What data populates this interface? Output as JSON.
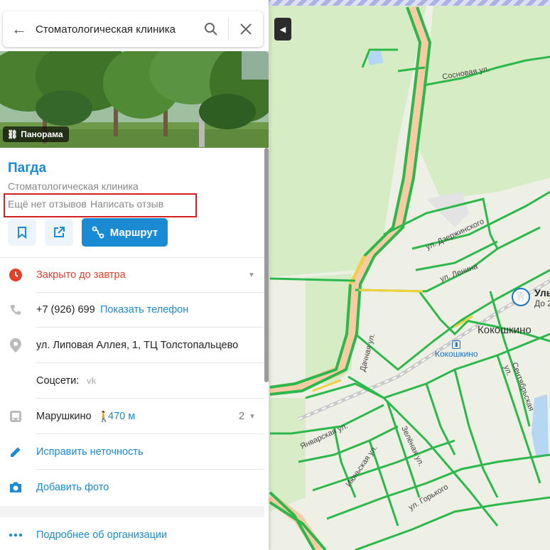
{
  "search": {
    "query": "Стоматологическая клиника"
  },
  "panorama": {
    "label": "Панорама"
  },
  "org": {
    "name": "Пагда",
    "category": "Стоматологическая клиника",
    "no_reviews": "Ещё нет отзывов",
    "write_review": "Написать отзыв"
  },
  "actions": {
    "route": "Маршрут"
  },
  "hours": {
    "status": "Закрыто до завтра"
  },
  "phone": {
    "number": "+7 (926) 699",
    "show": "Показать телефон"
  },
  "address": {
    "text": "ул. Липовая Аллея, 1, ТЦ Толстопальцево"
  },
  "social": {
    "label": "Соцсети:",
    "vk": "vk"
  },
  "transport": {
    "station": "Марушкино",
    "distance": "470 м",
    "count": "2"
  },
  "edit": {
    "label": "Исправить неточность"
  },
  "photo": {
    "label": "Добавить фото"
  },
  "more": {
    "label": "Подробнее об организации"
  },
  "map": {
    "streets": {
      "sosnovaya": "Сосновая ул.",
      "dzerzhinskogo": "ул. Дзержинского",
      "lenina": "ул. Ленина",
      "dachnaya": "Дачная ул.",
      "yanvarskaya": "Январская ул.",
      "iyunskaya": "Июньская ул.",
      "zelenaya": "Зелёная ул.",
      "sentyabrskaya": "Сентябрьская ул.",
      "gorkogo": "ул. Горького"
    },
    "locality": "Кокошкино",
    "station": "Кокошкино",
    "poi": {
      "title": "Уль",
      "subtitle": "До 2"
    }
  },
  "colors": {
    "accent": "#1a8ad2",
    "closed": "#e2402b",
    "traffic_free": "#2db84b",
    "traffic_slow": "#f2d13c",
    "highlight_box": "#d32121"
  }
}
